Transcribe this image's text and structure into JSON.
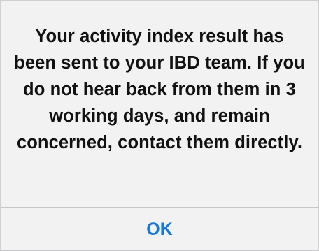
{
  "alert": {
    "message": "Your activity index result has been sent to your IBD team. If you do not hear back from them in 3 working days, and remain concerned, contact them directly.",
    "ok_label": "OK"
  },
  "colors": {
    "background": "#f2f2f3",
    "text": "#111111",
    "button": "#1479d6",
    "divider": "#c8c8cc"
  }
}
